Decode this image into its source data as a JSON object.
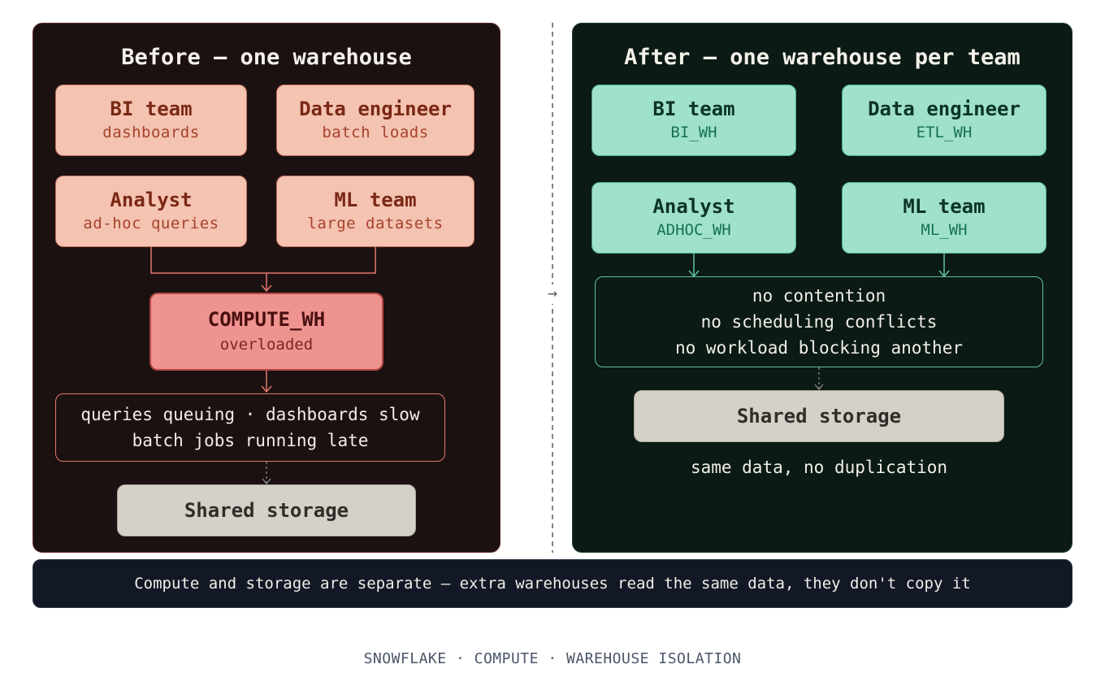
{
  "before": {
    "title": "Before — one warehouse",
    "teams": [
      {
        "name": "BI team",
        "desc": "dashboards"
      },
      {
        "name": "Data engineer",
        "desc": "batch loads"
      },
      {
        "name": "Analyst",
        "desc": "ad-hoc queries"
      },
      {
        "name": "ML team",
        "desc": "large datasets"
      }
    ],
    "warehouse": {
      "name": "COMPUTE_WH",
      "status": "overloaded"
    },
    "symptoms": [
      "queries queuing · dashboards slow",
      "batch jobs running late"
    ],
    "storage": "Shared storage"
  },
  "transition_arrow": "→",
  "after": {
    "title": "After — one warehouse per team",
    "teams": [
      {
        "name": "BI team",
        "warehouse": "BI_WH"
      },
      {
        "name": "Data engineer",
        "warehouse": "ETL_WH"
      },
      {
        "name": "Analyst",
        "warehouse": "ADHOC_WH"
      },
      {
        "name": "ML team",
        "warehouse": "ML_WH"
      }
    ],
    "benefits": [
      "no contention",
      "no scheduling conflicts",
      "no workload blocking another"
    ],
    "storage": "Shared storage",
    "storage_note": "same data, no duplication"
  },
  "banner": "Compute and storage are separate — extra warehouses read the same data, they don't copy it",
  "footer": "SNOWFLAKE · COMPUTE · WAREHOUSE ISOLATION",
  "colors": {
    "before_panel": "#1c1111",
    "after_panel": "#0b1a14",
    "before_team": "#f4c3b2",
    "after_team": "#9fe1c9",
    "overloaded_warehouse": "#ef9391",
    "storage": "#d4d1c8",
    "banner": "#121826"
  }
}
